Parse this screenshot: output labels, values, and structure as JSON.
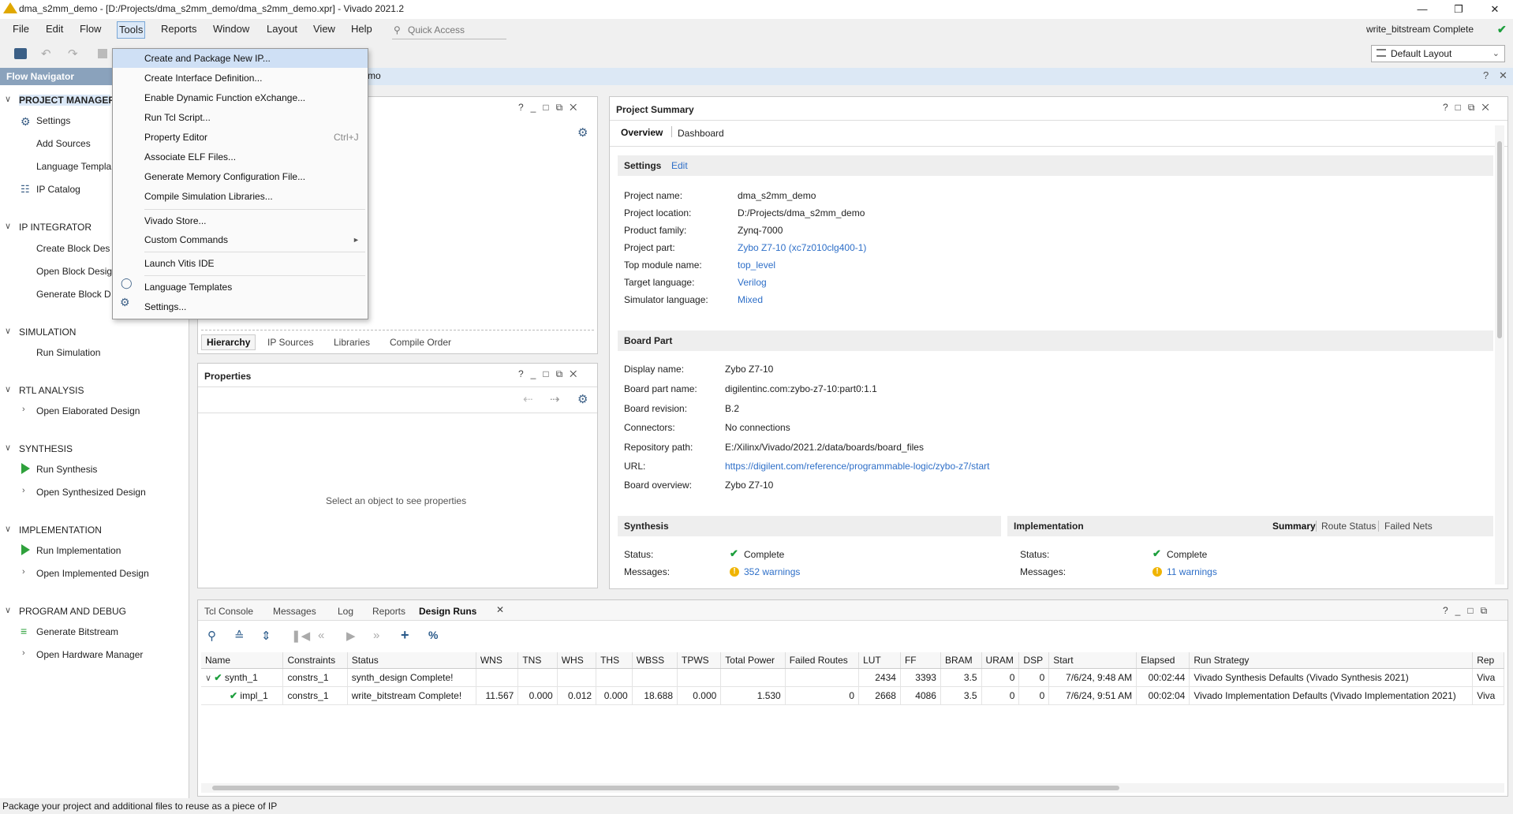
{
  "window": {
    "title": "dma_s2mm_demo - [D:/Projects/dma_s2mm_demo/dma_s2mm_demo.xpr] - Vivado 2021.2",
    "status": "write_bitstream Complete"
  },
  "menubar": [
    "File",
    "Edit",
    "Flow",
    "Tools",
    "Reports",
    "Window",
    "Layout",
    "View",
    "Help"
  ],
  "quick_access": "Quick Access",
  "layout_selector": "Default Layout",
  "banner_partial": "mo",
  "flow_nav": {
    "title": "Flow Navigator",
    "sections": [
      {
        "label": "PROJECT MANAGER",
        "items": [
          "Settings",
          "Add Sources",
          "Language Templa",
          "IP Catalog"
        ]
      },
      {
        "label": "IP INTEGRATOR",
        "items": [
          "Create Block Des",
          "Open Block Desig",
          "Generate Block D"
        ]
      },
      {
        "label": "SIMULATION",
        "items": [
          "Run Simulation"
        ]
      },
      {
        "label": "RTL ANALYSIS",
        "items": [
          "Open Elaborated Design"
        ]
      },
      {
        "label": "SYNTHESIS",
        "items": [
          "Run Synthesis",
          "Open Synthesized Design"
        ]
      },
      {
        "label": "IMPLEMENTATION",
        "items": [
          "Run Implementation",
          "Open Implemented Design"
        ]
      },
      {
        "label": "PROGRAM AND DEBUG",
        "items": [
          "Generate Bitstream",
          "Open Hardware Manager"
        ]
      }
    ]
  },
  "tools_menu": [
    {
      "label": "Create and Package New IP...",
      "shortcut": ""
    },
    {
      "label": "Create Interface Definition...",
      "shortcut": ""
    },
    {
      "label": "Enable Dynamic Function eXchange...",
      "shortcut": ""
    },
    {
      "label": "Run Tcl Script...",
      "shortcut": ""
    },
    {
      "label": "Property Editor",
      "shortcut": "Ctrl+J"
    },
    {
      "label": "Associate ELF Files...",
      "shortcut": ""
    },
    {
      "label": "Generate Memory Configuration File...",
      "shortcut": ""
    },
    {
      "label": "Compile Simulation Libraries...",
      "shortcut": ""
    },
    {
      "label": "Vivado Store...",
      "shortcut": ""
    },
    {
      "label": "Custom Commands",
      "shortcut": ""
    },
    {
      "label": "Launch Vitis IDE",
      "shortcut": ""
    },
    {
      "label": "Language Templates",
      "shortcut": ""
    },
    {
      "label": "Settings...",
      "shortcut": ""
    }
  ],
  "sources_tabs": [
    "Hierarchy",
    "IP Sources",
    "Libraries",
    "Compile Order"
  ],
  "properties": {
    "title": "Properties",
    "empty": "Select an object to see properties"
  },
  "summary": {
    "title": "Project Summary",
    "tabs": [
      "Overview",
      "Dashboard"
    ],
    "settings_title": "Settings",
    "edit_label": "Edit",
    "settings": [
      {
        "k": "Project name:",
        "v": "dma_s2mm_demo"
      },
      {
        "k": "Project location:",
        "v": "D:/Projects/dma_s2mm_demo"
      },
      {
        "k": "Product family:",
        "v": "Zynq-7000"
      },
      {
        "k": "Project part:",
        "v": "Zybo Z7-10 (xc7z010clg400-1)"
      },
      {
        "k": "Top module name:",
        "v": "top_level"
      },
      {
        "k": "Target language:",
        "v": "Verilog"
      },
      {
        "k": "Simulator language:",
        "v": "Mixed"
      }
    ],
    "board_title": "Board Part",
    "board": [
      {
        "k": "Display name:",
        "v": "Zybo Z7-10"
      },
      {
        "k": "Board part name:",
        "v": "digilentinc.com:zybo-z7-10:part0:1.1"
      },
      {
        "k": "Board revision:",
        "v": "B.2"
      },
      {
        "k": "Connectors:",
        "v": "No connections"
      },
      {
        "k": "Repository path:",
        "v": "E:/Xilinx/Vivado/2021.2/data/boards/board_files"
      },
      {
        "k": "URL:",
        "v": "https://digilent.com/reference/programmable-logic/zybo-z7/start"
      },
      {
        "k": "Board overview:",
        "v": "Zybo Z7-10"
      }
    ],
    "synthesis": {
      "title": "Synthesis",
      "status_k": "Status:",
      "status_v": "Complete",
      "msg_k": "Messages:",
      "msg_v": "352 warnings"
    },
    "implementation": {
      "title": "Implementation",
      "tabs": [
        "Summary",
        "Route Status",
        "Failed Nets"
      ],
      "status_k": "Status:",
      "status_v": "Complete",
      "msg_k": "Messages:",
      "msg_v": "11 warnings"
    }
  },
  "bottom_tabs": [
    "Tcl Console",
    "Messages",
    "Log",
    "Reports",
    "Design Runs"
  ],
  "runs": {
    "columns": [
      "Name",
      "Constraints",
      "Status",
      "WNS",
      "TNS",
      "WHS",
      "THS",
      "WBSS",
      "TPWS",
      "Total Power",
      "Failed Routes",
      "LUT",
      "FF",
      "BRAM",
      "URAM",
      "DSP",
      "Start",
      "Elapsed",
      "Run Strategy",
      "Rep"
    ],
    "rows": [
      [
        "synth_1",
        "constrs_1",
        "synth_design Complete!",
        "",
        "",
        "",
        "",
        "",
        "",
        "",
        "",
        "2434",
        "3393",
        "3.5",
        "0",
        "0",
        "7/6/24, 9:48 AM",
        "00:02:44",
        "Vivado Synthesis Defaults (Vivado Synthesis 2021)",
        "Viva"
      ],
      [
        "impl_1",
        "constrs_1",
        "write_bitstream Complete!",
        "11.567",
        "0.000",
        "0.012",
        "0.000",
        "18.688",
        "0.000",
        "1.530",
        "0",
        "2668",
        "4086",
        "3.5",
        "0",
        "0",
        "7/6/24, 9:51 AM",
        "00:02:04",
        "Vivado Implementation Defaults (Vivado Implementation 2021)",
        "Viva"
      ]
    ]
  },
  "statusbar": "Package your project and additional files to reuse as a piece of IP"
}
